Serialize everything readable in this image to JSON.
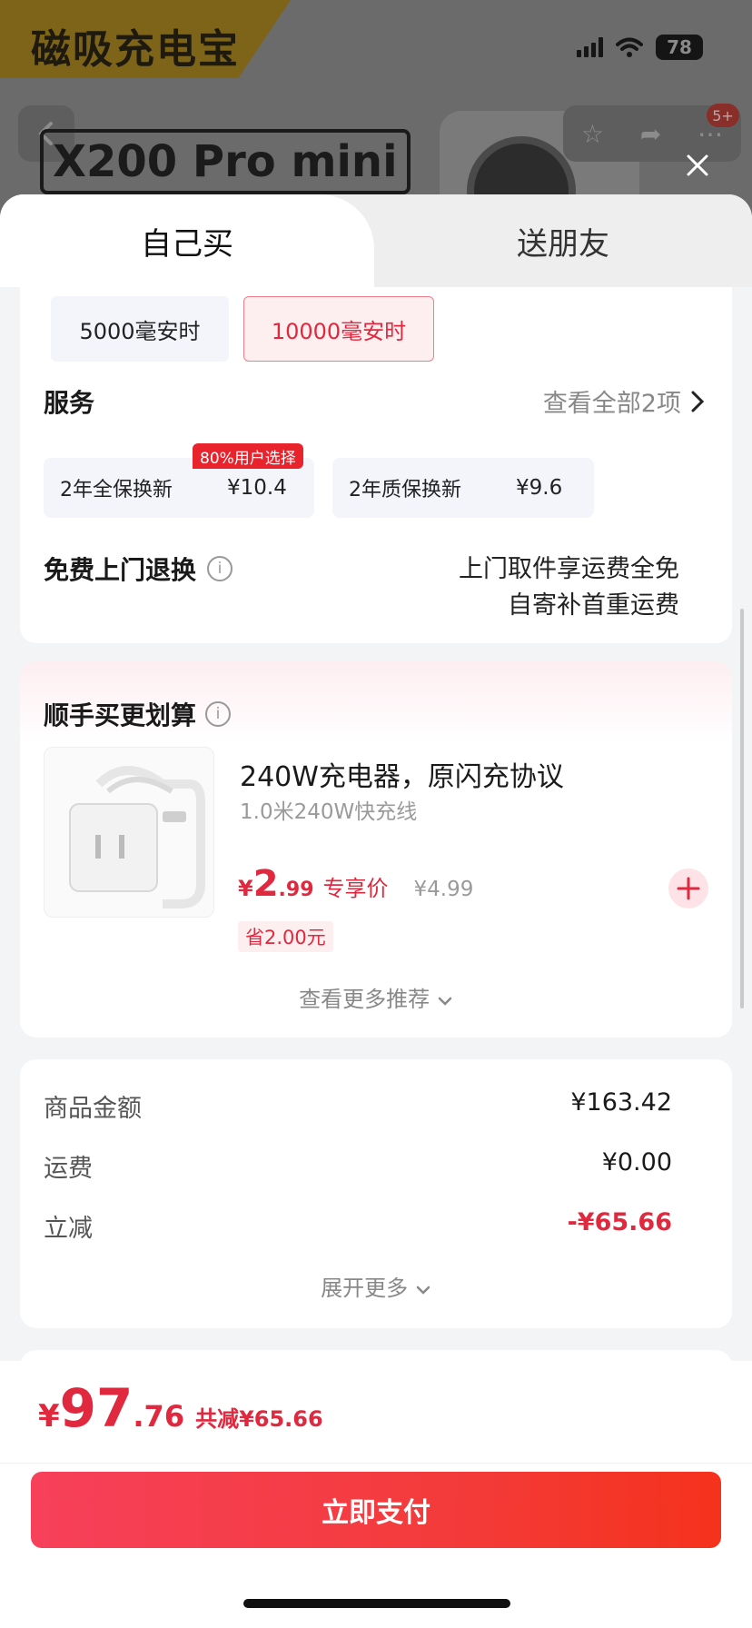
{
  "background": {
    "brand": "磁吸充电宝",
    "model": "X200 Pro mini",
    "battery": "78",
    "badge": "5+"
  },
  "tabs": [
    {
      "label": "自己买"
    },
    {
      "label": "送朋友"
    }
  ],
  "capacity_options": [
    {
      "label": "5000毫安时",
      "selected": false
    },
    {
      "label": "10000毫安时",
      "selected": true
    }
  ],
  "service": {
    "title": "服务",
    "view_all": "查看全部2项",
    "options": [
      {
        "name": "2年全保换新",
        "price": "¥10.4",
        "tag": "80%用户选择"
      },
      {
        "name": "2年质保换新",
        "price": "¥9.6"
      }
    ]
  },
  "return": {
    "title": "免费上门退换",
    "line1": "上门取件享运费全免",
    "line2": "自寄补首重运费"
  },
  "bundle": {
    "title": "顺手买更划算",
    "product": {
      "name": "240W充电器，原闪充协议",
      "subtitle": "1.0米240W快充线",
      "price_yen": "¥",
      "price_int": "2",
      "price_dec": ".99",
      "price_label": "专享价",
      "original_price": "¥4.99",
      "save": "省2.00元"
    },
    "more": "查看更多推荐"
  },
  "summary": {
    "rows": [
      {
        "label": "商品金额",
        "value": "¥163.42"
      },
      {
        "label": "运费",
        "value": "¥0.00"
      },
      {
        "label": "立减",
        "value": "-¥65.66"
      }
    ],
    "expand": "展开更多"
  },
  "footer": {
    "total_yen": "¥",
    "total_int": "97",
    "total_dec": ".76",
    "total_saved": "共减¥65.66",
    "pay_button": "立即支付"
  },
  "colors": {
    "accent": "#e0283e",
    "pay_gradient_start": "#f7405a",
    "pay_gradient_end": "#f5321c"
  }
}
